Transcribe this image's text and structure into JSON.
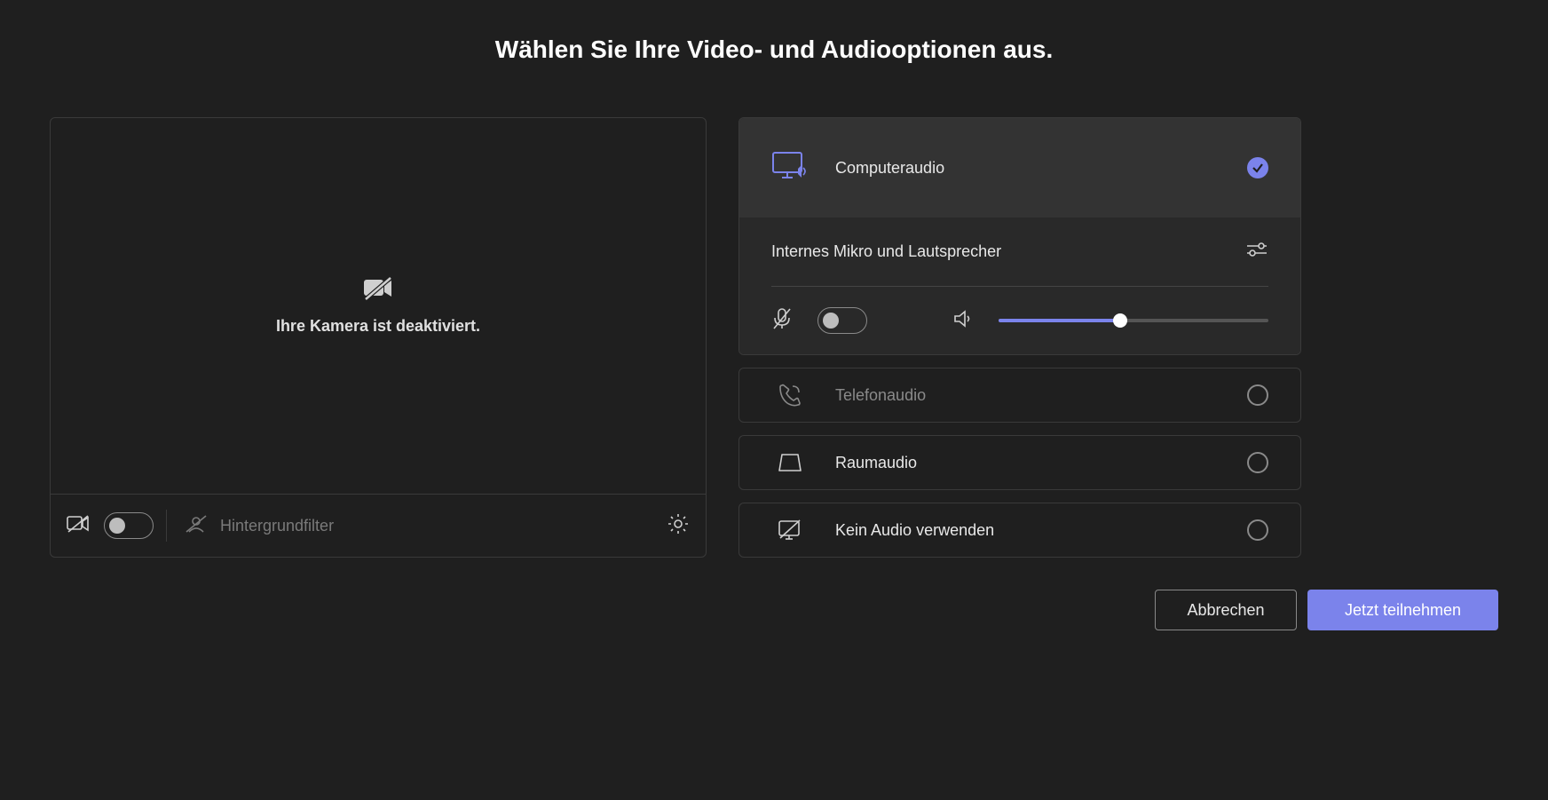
{
  "title": "Wählen Sie Ihre Video- und Audiooptionen aus.",
  "video": {
    "camera_status": "Ihre Kamera ist deaktiviert.",
    "bg_filter_label": "Hintergrundfilter"
  },
  "audio": {
    "options": {
      "computer": "Computeraudio",
      "phone": "Telefonaudio",
      "room": "Raumaudio",
      "none": "Kein Audio verwenden"
    },
    "device_label": "Internes Mikro und Lautsprecher",
    "volume_percent": 45
  },
  "footer": {
    "cancel": "Abbrechen",
    "join": "Jetzt teilnehmen"
  },
  "colors": {
    "accent": "#7b83eb"
  }
}
